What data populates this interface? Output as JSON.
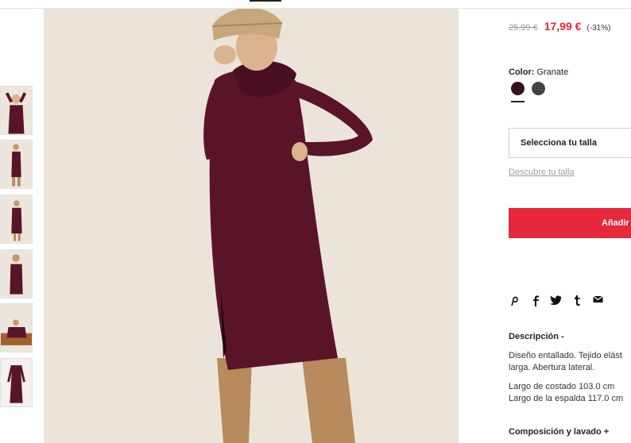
{
  "product": {
    "old_price": "25,99 €",
    "new_price": "17,99 €",
    "discount": "(-31%)",
    "color_label": "Color:",
    "color_value": "Granate",
    "colors": [
      {
        "name": "Granate",
        "hex": "#3b0f22",
        "selected": true
      },
      {
        "name": "Gris",
        "hex": "#3b3b3b",
        "selected": false
      }
    ],
    "size_select_label": "Selecciona tu talla",
    "size_guide_link": "Descubre tu talla",
    "add_button_label": "Añadir",
    "description_title": "Descripción -",
    "description_lines": [
      "Diseño entallado. Tejido elást",
      "larga. Abertura lateral."
    ],
    "measure_lines": [
      "Largo de costado 103.0 cm",
      "Largo de la espalda 117.0 cm"
    ],
    "composition_title": "Composición y lavado +"
  },
  "share_icons": [
    "pinterest-icon",
    "facebook-icon",
    "twitter-icon",
    "tumblr-icon",
    "email-icon"
  ],
  "colors": {
    "accent": "#e6283c",
    "sale_price": "#e3263a",
    "dress": "#5a1428"
  }
}
